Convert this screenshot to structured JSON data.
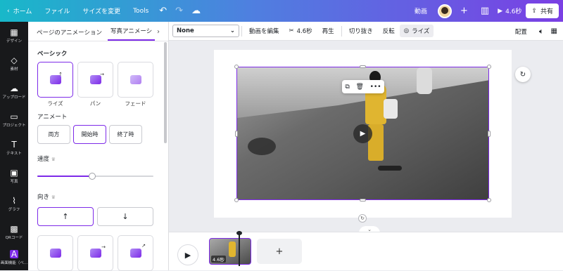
{
  "topbar": {
    "home": "ホーム",
    "file": "ファイル",
    "resize": "サイズを変更",
    "tools": "Tools",
    "doc_type": "動画",
    "duration": "4.6秒",
    "share": "共有"
  },
  "sidenav": {
    "items": [
      {
        "label": "デザイン",
        "icon": "design-icon"
      },
      {
        "label": "素材",
        "icon": "elements-icon"
      },
      {
        "label": "アップロード",
        "icon": "upload-icon"
      },
      {
        "label": "プロジェクト",
        "icon": "folder-icon"
      },
      {
        "label": "テキスト",
        "icon": "text-icon"
      },
      {
        "label": "写真",
        "icon": "photo-icon"
      },
      {
        "label": "グラフ",
        "icon": "chart-icon"
      },
      {
        "label": "QRコード",
        "icon": "qr-icon"
      },
      {
        "label": "画面機能（ベ…",
        "icon": "apps-icon"
      }
    ]
  },
  "panel": {
    "tabs": [
      "ページのアニメーション",
      "写真アニメーシ"
    ],
    "basic_title": "ベーシック",
    "animations": [
      {
        "name": "ライズ",
        "selected": true
      },
      {
        "name": "パン",
        "selected": false
      },
      {
        "name": "フェード",
        "selected": false
      }
    ],
    "animate_label": "アニメート",
    "animate_options": [
      {
        "label": "両方",
        "selected": false
      },
      {
        "label": "開始時",
        "selected": true
      },
      {
        "label": "終了時",
        "selected": false
      }
    ],
    "speed_label": "速度",
    "speed_value": 0.47,
    "direction_label": "向き",
    "directions": [
      {
        "label": "↑",
        "selected": true
      },
      {
        "label": "↓",
        "selected": false
      }
    ]
  },
  "toolbar": {
    "font_select": "None",
    "edit_video": "動画を編集",
    "duration": "4.6秒",
    "play": "再生",
    "crop": "切り抜き",
    "flip": "反転",
    "rise": "ライズ",
    "position": "配置"
  },
  "timeline": {
    "clip_duration": "4.6秒"
  },
  "colors": {
    "accent": "#7d2ae8",
    "topbar_start": "#18b8c9",
    "topbar_end": "#7a3fe4"
  }
}
